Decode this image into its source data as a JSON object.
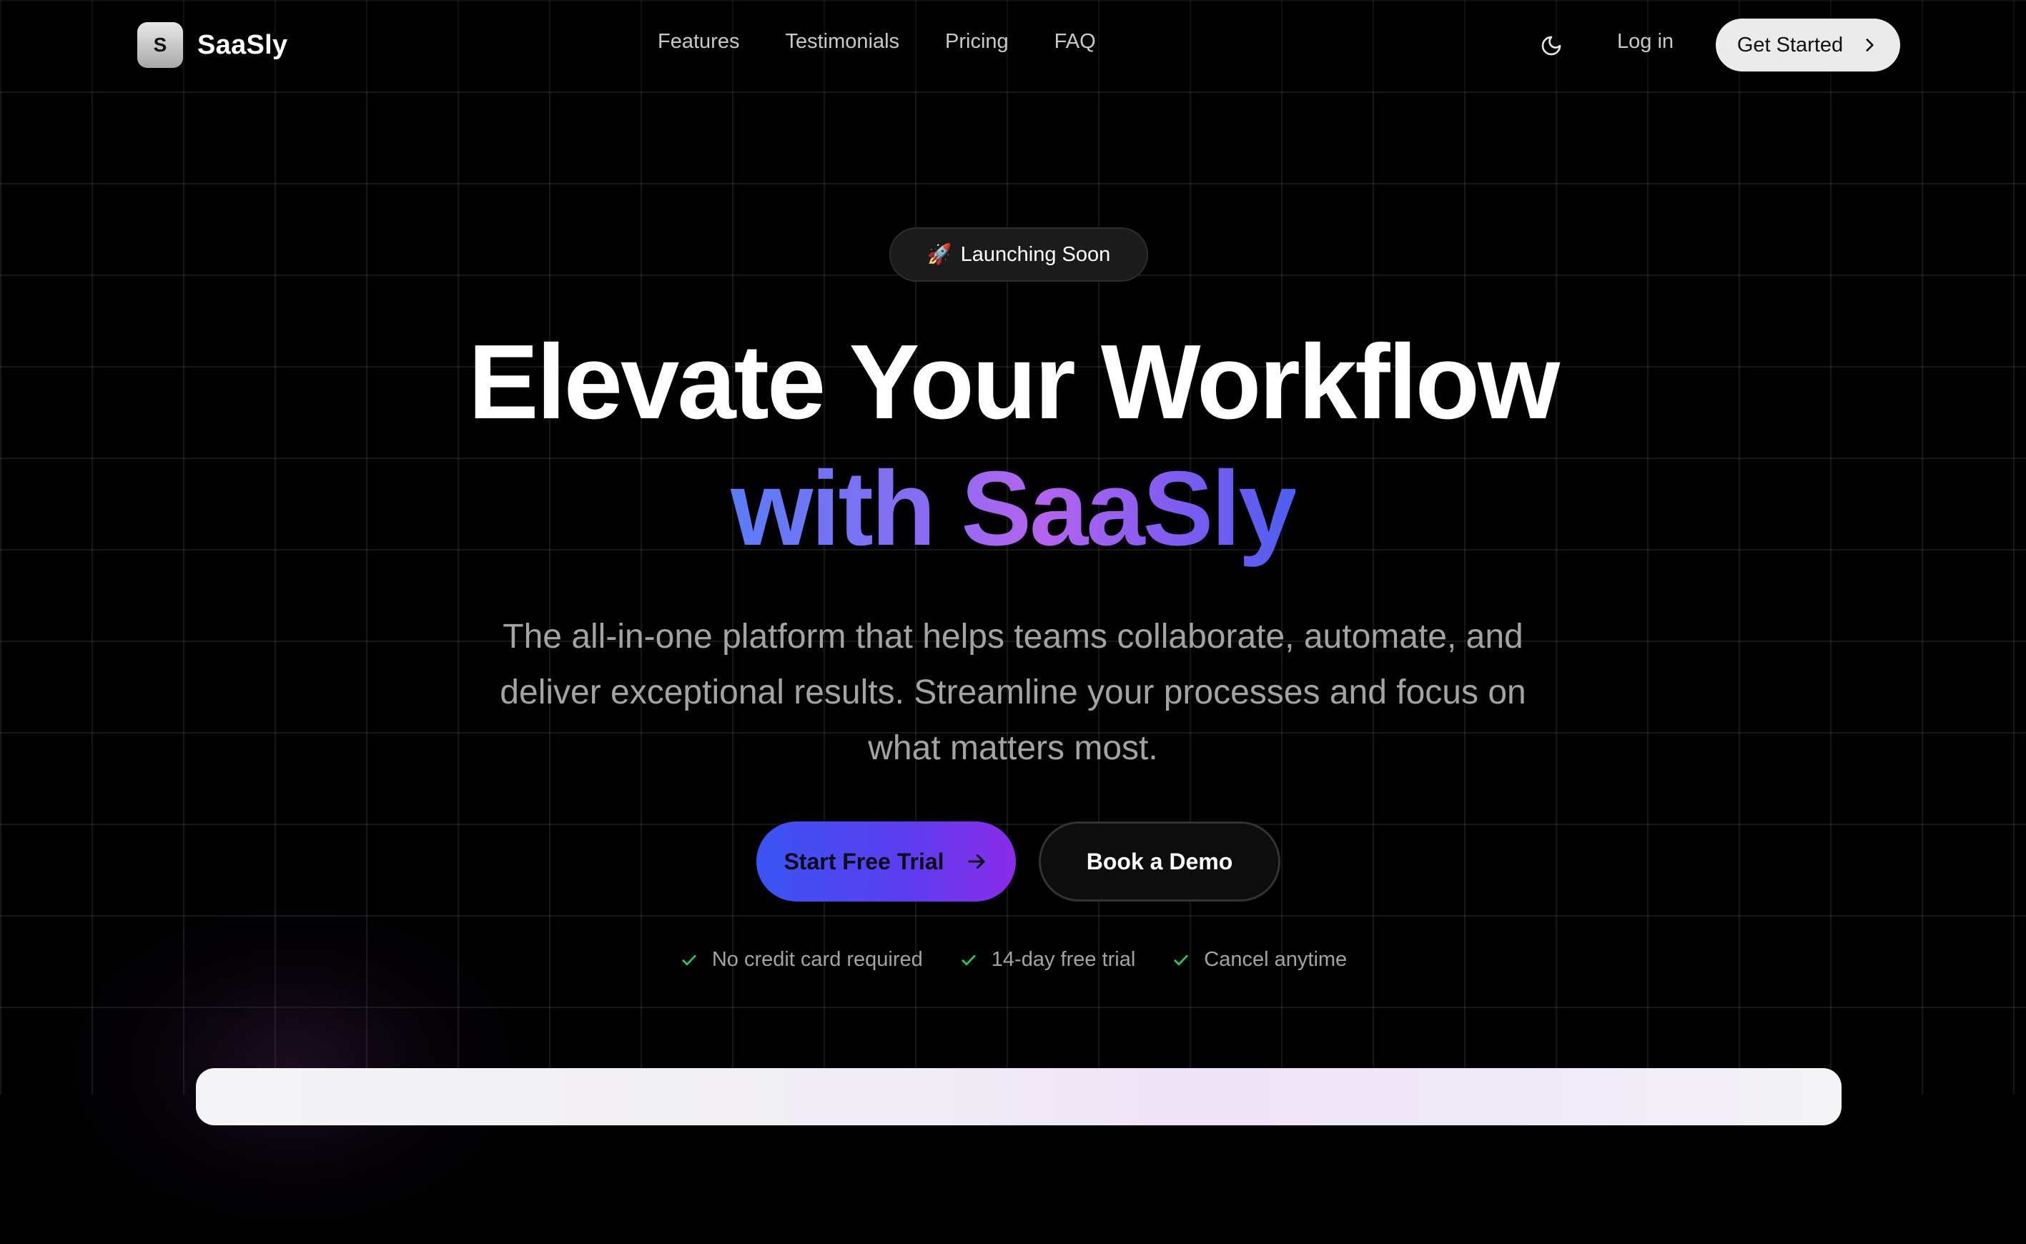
{
  "brand": {
    "logo_letter": "S",
    "name": "SaaSly"
  },
  "nav": {
    "links": [
      {
        "label": "Features"
      },
      {
        "label": "Testimonials"
      },
      {
        "label": "Pricing"
      },
      {
        "label": "FAQ"
      }
    ],
    "theme_toggle_icon": "moon-icon",
    "login_label": "Log in",
    "get_started_label": "Get Started"
  },
  "hero": {
    "badge_icon": "rocket-icon",
    "badge_emoji": "🚀",
    "badge_text": "Launching Soon",
    "headline_line1": "Elevate Your Workflow",
    "headline_line2": "with SaaSly",
    "subtext_lines": [
      "The all-in-one platform that helps teams collaborate, automate, and",
      "deliver exceptional results. Streamline your processes and focus on",
      "what matters most."
    ],
    "primary_cta": "Start Free Trial",
    "secondary_cta": "Book a Demo",
    "perks": [
      {
        "label": "No credit card required"
      },
      {
        "label": "14-day free trial"
      },
      {
        "label": "Cancel anytime"
      }
    ]
  },
  "colors": {
    "background": "#000000",
    "accent_blue": "#3a54f3",
    "accent_purple": "#8a2ce8",
    "check_green": "#22c55e"
  }
}
